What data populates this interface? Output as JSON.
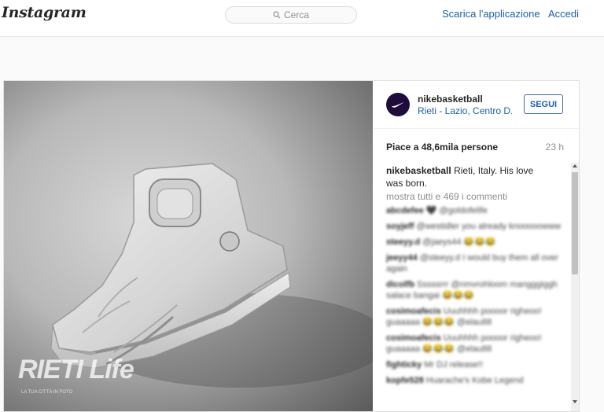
{
  "header": {
    "logo_text": "Instagram",
    "search_placeholder": "Cerca",
    "download_link": "Scarica l'applicazione",
    "login_link": "Accedi"
  },
  "photo": {
    "watermark_title": "RIETI Life",
    "watermark_sub": "LA TUA CITTÀ IN FOTO"
  },
  "post": {
    "username": "nikebasketball",
    "location": "Rieti - Lazio, Centro D...",
    "follow_label": "SEGUI",
    "likes": "Piace a 48,6mila persone",
    "time": "23 h",
    "caption_user": "nikebasketball",
    "caption_text": "Rieti, Italy. His love was born.",
    "view_all": "mostra tutti e 469 i commenti",
    "comments": [
      {
        "user": "abcdefee",
        "text": "🖤 @goldofelife"
      },
      {
        "user": "soyjeff",
        "text": "@westidler you already knooooowww"
      },
      {
        "user": "steeyy.d",
        "text": "@jaeys44 😂😂😂"
      },
      {
        "user": "jeeyy44",
        "text": "@steeyy.d I would buy them all over again"
      },
      {
        "user": "dicolfb",
        "text": "Sssssrrr @nmvrohloom mangggiggh salace bangai 😂😂😂"
      },
      {
        "user": "cosimoafecis",
        "text": "Uuuhhhh poooor righeoo! guaaaaa 😂😂😂 @elau88"
      },
      {
        "user": "cosimoafecis",
        "text": "Uuuhhhh poooor righeoo! guaaaaa 😂😂😂 @elau88"
      },
      {
        "user": "fighticky",
        "text": "Mr DJ release!!"
      },
      {
        "user": "kopfe528",
        "text": "Huarache's Kobe Legend"
      }
    ]
  },
  "colors": {
    "link": "#1c5fa8",
    "avatar_bg": "#1e0c3a"
  }
}
